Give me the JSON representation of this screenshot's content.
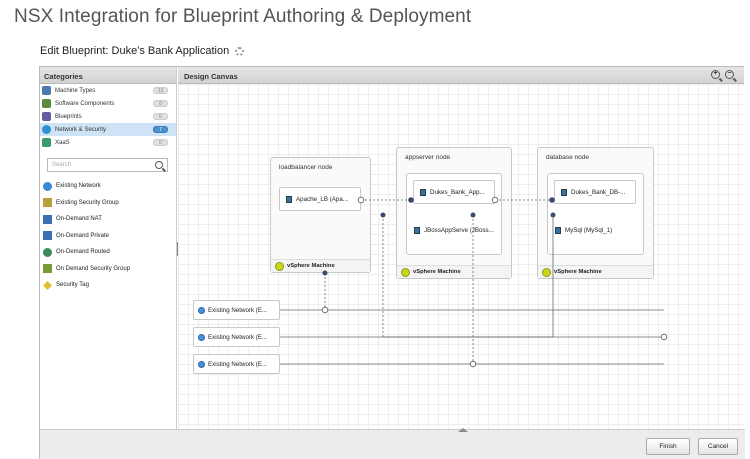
{
  "slide": {
    "title": "NSX Integration for Blueprint Authoring & Deployment"
  },
  "blueprint": {
    "title": "Edit Blueprint: Duke's Bank Application"
  },
  "left_panel": {
    "header": "Categories",
    "categories": [
      {
        "label": "Machine Types",
        "count": "13",
        "icon_color": "#4a7ab0"
      },
      {
        "label": "Software Components",
        "count": "0",
        "icon_color": "#5a8a3a"
      },
      {
        "label": "Blueprints",
        "count": "0",
        "icon_color": "#6a5aa0"
      },
      {
        "label": "Network & Security",
        "count": "7",
        "icon_color": "#2f8fcf",
        "selected": true
      },
      {
        "label": "XaaS",
        "count": "0",
        "icon_color": "#3a9a6a"
      }
    ],
    "search_placeholder": "Search",
    "palette": [
      {
        "label": "Existing Network",
        "icon": "globe-icon",
        "color": "#3a88d0"
      },
      {
        "label": "Existing Security Group",
        "icon": "shield-icon",
        "color": "#b9a03a"
      },
      {
        "label": "On-Demand NAT",
        "icon": "nat-icon",
        "color": "#3a70b0"
      },
      {
        "label": "On-Demand Private",
        "icon": "private-network-icon",
        "color": "#3a70b0"
      },
      {
        "label": "On-Demand Routed",
        "icon": "routed-network-icon",
        "color": "#3a8a5a"
      },
      {
        "label": "On Demand Security Group",
        "icon": "security-group-icon",
        "color": "#7a9a3a"
      },
      {
        "label": "Security Tag",
        "icon": "tag-icon",
        "color": "#e0c030"
      }
    ]
  },
  "canvas": {
    "header": "Design Canvas",
    "nodes": {
      "lb": {
        "title": "loadbalancer node",
        "component": "Apache_LB (Apa...",
        "footer": "vSphere Machine"
      },
      "app": {
        "title": "appserver node",
        "component1": "Dukes_Bank_App...",
        "component2": "JBossAppServe (JBoss...",
        "footer": "vSphere Machine"
      },
      "db": {
        "title": "database node",
        "component1": "Dukes_Bank_DB-...",
        "component2": "MySql (MySql_1)",
        "footer": "vSphere Machine"
      }
    },
    "networks": [
      "Existing Network (E...",
      "Existing Network (E...",
      "Existing Network (E..."
    ]
  },
  "footer": {
    "finish_label": "Finish",
    "cancel_label": "Cancel"
  }
}
